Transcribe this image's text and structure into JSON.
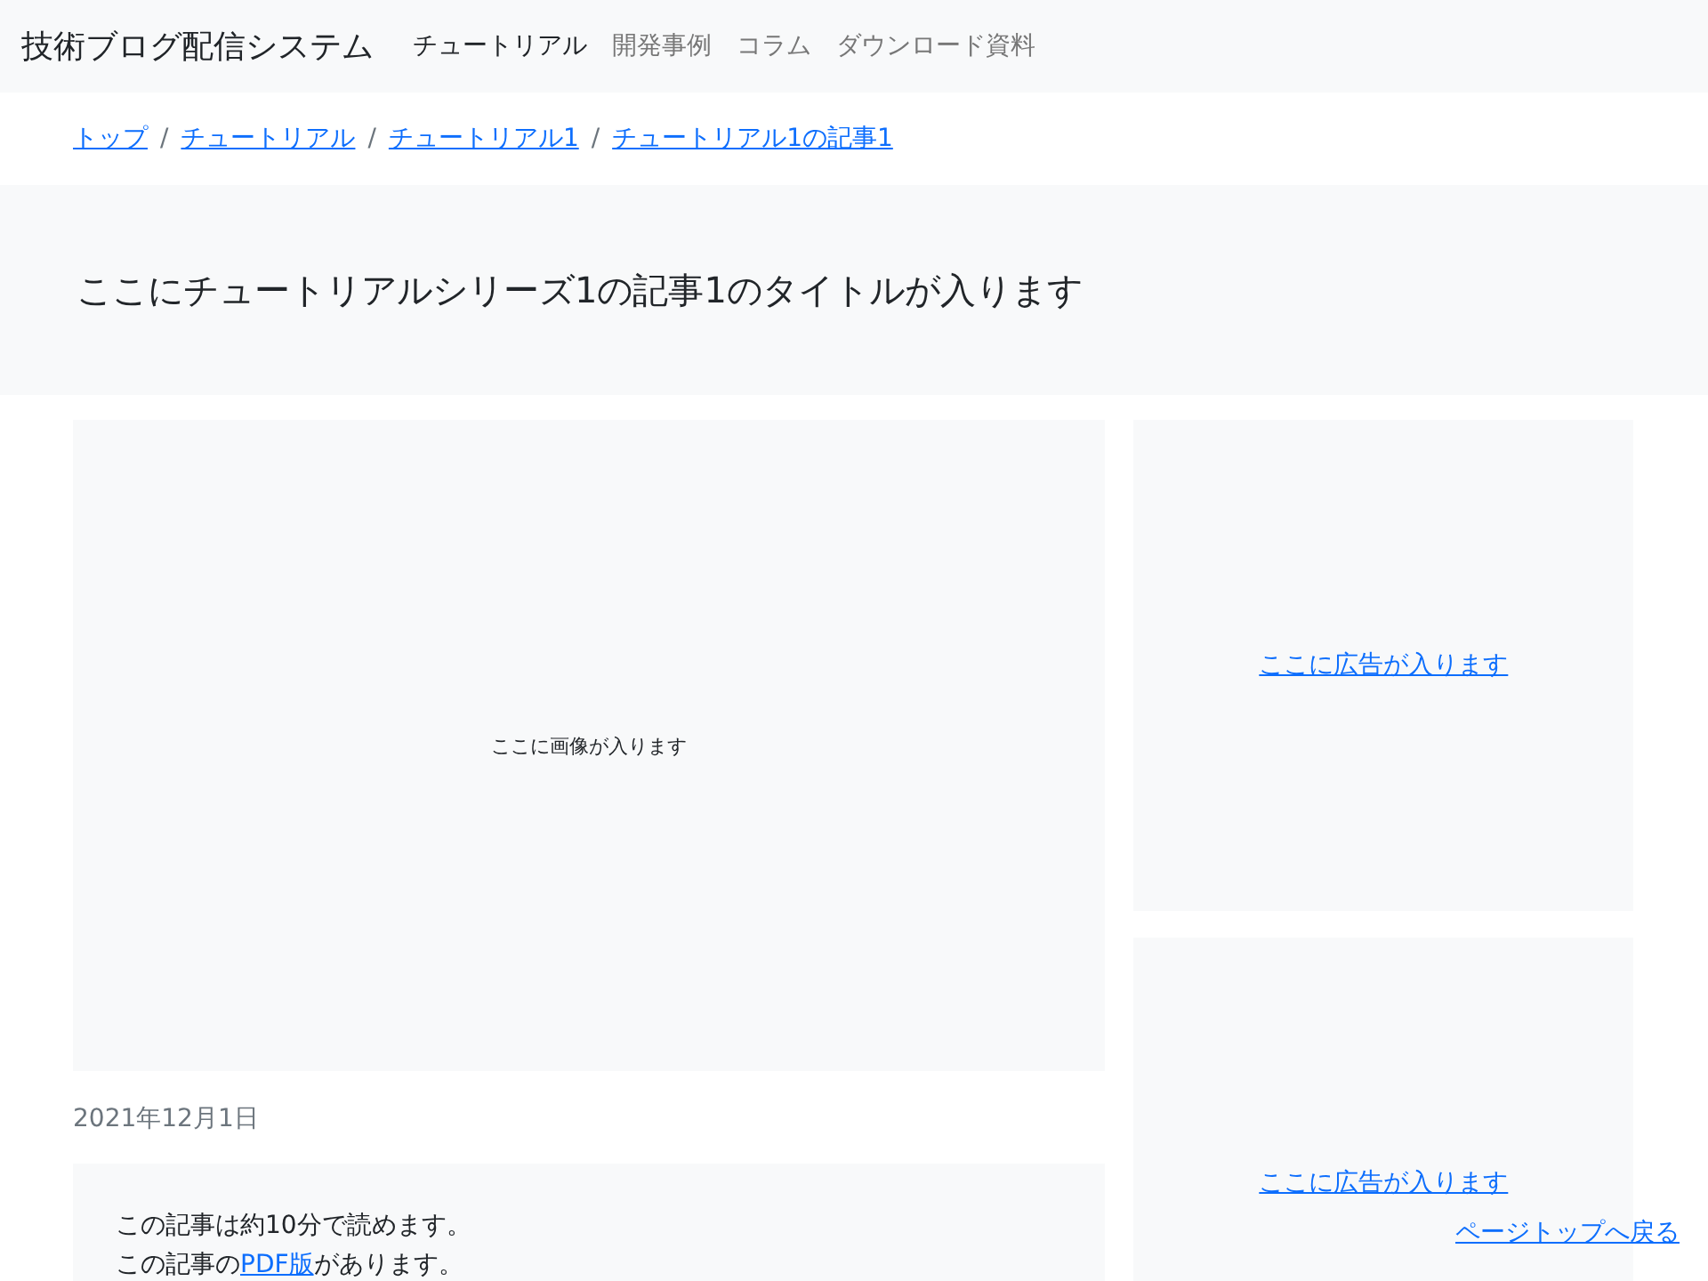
{
  "navbar": {
    "brand": "技術ブログ配信システム",
    "items": [
      {
        "label": "チュートリアル",
        "selected": true
      },
      {
        "label": "開発事例",
        "selected": false
      },
      {
        "label": "コラム",
        "selected": false
      },
      {
        "label": "ダウンロード資料",
        "selected": false
      }
    ]
  },
  "breadcrumb": [
    "トップ",
    "チュートリアル",
    "チュートリアル1",
    "チュートリアル1の記事1"
  ],
  "breadcrumb_separator": "/",
  "title": "ここにチュートリアルシリーズ1の記事1のタイトルが入ります",
  "image_placeholder": "ここに画像が入ります",
  "date": "2021年12月1日",
  "note": {
    "line1": "この記事は約10分で読めます。",
    "line2_before": "この記事の",
    "line2_link": "PDF版",
    "line2_after": "があります。"
  },
  "ads": [
    "ここに広告が入ります",
    "ここに広告が入ります"
  ],
  "page_top_link": "ページトップへ戻る"
}
